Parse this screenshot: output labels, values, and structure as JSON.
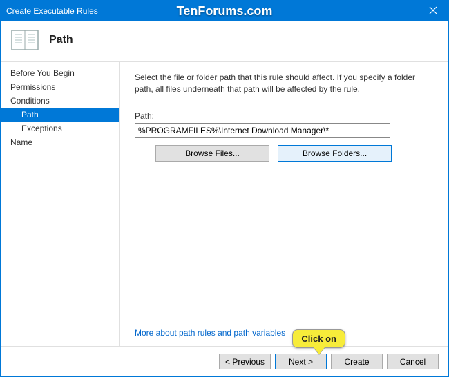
{
  "watermark": "TenForums.com",
  "window": {
    "title": "Create Executable Rules"
  },
  "header": {
    "page_title": "Path"
  },
  "sidebar": {
    "items": [
      {
        "label": "Before You Begin"
      },
      {
        "label": "Permissions"
      },
      {
        "label": "Conditions"
      },
      {
        "label": "Path"
      },
      {
        "label": "Exceptions"
      },
      {
        "label": "Name"
      }
    ]
  },
  "content": {
    "instruction": "Select the file or folder path that this rule should affect. If you specify a folder path, all files underneath that path will be affected by the rule.",
    "path_label": "Path:",
    "path_value": "%PROGRAMFILES%\\Internet Download Manager\\*",
    "browse_files": "Browse Files...",
    "browse_folders": "Browse Folders...",
    "help_link": "More about path rules and path variables"
  },
  "footer": {
    "previous": "< Previous",
    "next": "Next >",
    "create": "Create",
    "cancel": "Cancel"
  },
  "callout": {
    "text": "Click on"
  }
}
